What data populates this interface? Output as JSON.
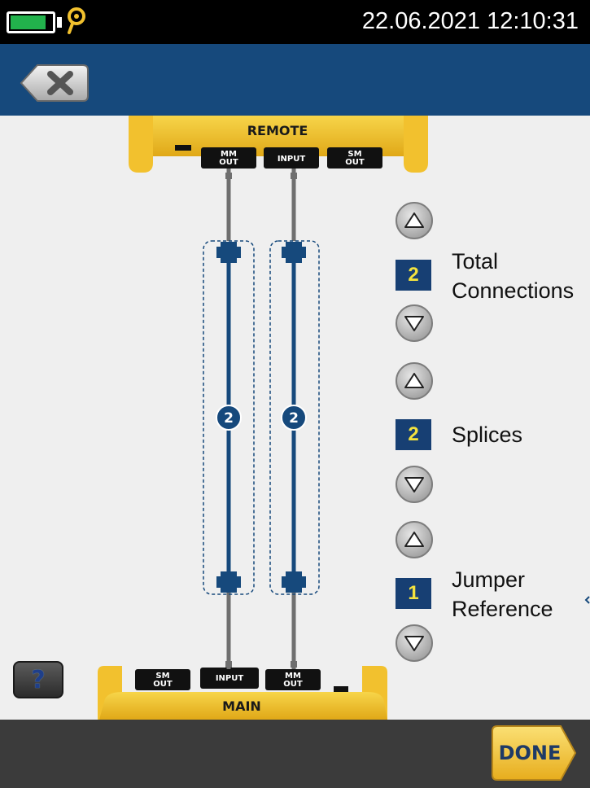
{
  "status_bar": {
    "datetime": "22.06.2021 12:10:31",
    "battery_level": 0.85,
    "battery_color": "#22b24c",
    "battery_icon": "battery-icon",
    "locator_icon": "location-pin-icon"
  },
  "title_bar": {
    "background": "#16497c",
    "close_icon": "close-icon"
  },
  "diagram": {
    "remote_label": "REMOTE",
    "main_label": "MAIN",
    "remote_ports": [
      "MM OUT",
      "INPUT",
      "SM OUT"
    ],
    "main_ports": [
      "SM OUT",
      "INPUT",
      "MM OUT"
    ],
    "fiber_1_splices": "2",
    "fiber_2_splices": "2"
  },
  "settings": {
    "total_connections": {
      "value": "2",
      "label_line1": "Total",
      "label_line2": "Connections"
    },
    "splices": {
      "value": "2",
      "label": "Splices"
    },
    "jumper_reference": {
      "value": "1",
      "label_line1": "Jumper",
      "label_line2": "Reference"
    }
  },
  "help": {
    "label": "?"
  },
  "footer": {
    "done_label": "DONE"
  },
  "colors": {
    "fiber": "#16497c",
    "accent_yellow": "#f2c12e",
    "value_text": "#f3e23f"
  }
}
